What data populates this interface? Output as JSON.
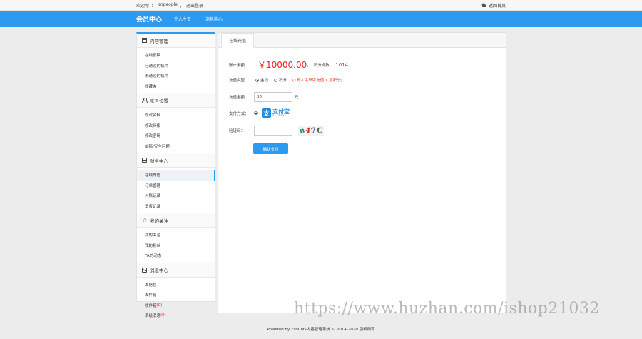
{
  "topbar": {
    "welcome": "欢迎你",
    "username": "Impeople",
    "logout": "退出登录",
    "home_link": "返回首页"
  },
  "nav": {
    "brand": "会员中心",
    "links": [
      "个人主页",
      "消息中心"
    ]
  },
  "sidebar": {
    "groups": [
      {
        "title": "内容管理",
        "icon": "document-icon",
        "items": [
          "在线投稿",
          "已通过的稿件",
          "未通过的稿件",
          "收藏夹"
        ]
      },
      {
        "title": "账号设置",
        "icon": "user-icon",
        "items": [
          "修改资料",
          "修改头像",
          "修改密码",
          "邮箱/安全问题"
        ]
      },
      {
        "title": "财务中心",
        "icon": "wallet-icon",
        "items": [
          "在线充值",
          "订单管理",
          "入账记录",
          "消费记录"
        ]
      },
      {
        "title": "我的关注",
        "icon": "star-icon",
        "items": [
          "我的关注",
          "我的粉丝",
          "TA的动态"
        ]
      },
      {
        "title": "消息中心",
        "icon": "mail-icon",
        "items": [
          "发信息",
          "发件箱",
          "收件箱",
          "系统消息"
        ]
      }
    ],
    "active_item": "在线充值",
    "inbox_count": "(0)",
    "system_count": "(0)"
  },
  "main": {
    "tab": "在线充值",
    "balance_label": "账户余额：",
    "balance_value": "￥10000.00",
    "balance_sep": "，",
    "points_label": "积分点数：",
    "points_value": "1014",
    "type_label": "充值类型：",
    "type_options": [
      "金钱",
      "积分"
    ],
    "type_selected": "金钱",
    "type_hint": "(1元人民币可充值 1 点积分)",
    "amount_label": "充值金额：",
    "amount_value": "30",
    "amount_unit": "元",
    "payment_label": "支付方式：",
    "payment_name_cn": "支付宝",
    "payment_name_en": "ALIPAY",
    "captcha_label": "验证码：",
    "captcha_text": [
      "n",
      "4",
      "7",
      "C"
    ],
    "submit": "确认支付"
  },
  "footer": "Powered by YznCMS内容管理系统 © 2014-2020 版权所有",
  "watermark": "https://www.huzhan.com/ishop21032",
  "colors": {
    "accent": "#2c9af0",
    "price": "#e22222",
    "alipay": "#1a8ce3"
  }
}
